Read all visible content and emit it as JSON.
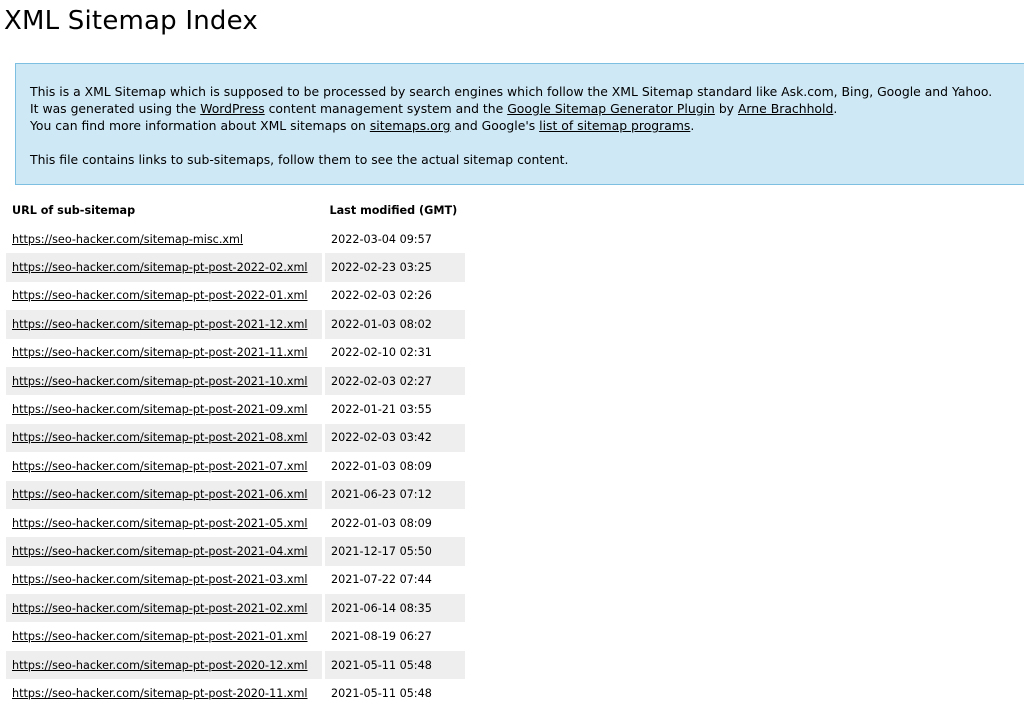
{
  "page": {
    "title": "XML Sitemap Index"
  },
  "intro": {
    "line1": "This is a XML Sitemap which is supposed to be processed by search engines which follow the XML Sitemap standard like Ask.com, Bing, Google and Yahoo.",
    "line2_pre": "It was generated using the ",
    "wordpress_link": "WordPress",
    "line2_mid1": " content management system and the ",
    "plugin_link": "Google Sitemap Generator Plugin",
    "line2_mid2": " by ",
    "author_link": "Arne Brachhold",
    "line2_post": ".",
    "line3_pre": "You can find more information about XML sitemaps on ",
    "sitemaps_link": "sitemaps.org",
    "line3_mid": " and Google's ",
    "programs_link": "list of sitemap programs",
    "line3_post": ".",
    "line4": "This file contains links to sub-sitemaps, follow them to see the actual sitemap content."
  },
  "table": {
    "headers": {
      "url": "URL of sub-sitemap",
      "modified": "Last modified (GMT)"
    },
    "rows": [
      {
        "url": "https://seo-hacker.com/sitemap-misc.xml",
        "modified": "2022-03-04 09:57"
      },
      {
        "url": "https://seo-hacker.com/sitemap-pt-post-2022-02.xml",
        "modified": "2022-02-23 03:25"
      },
      {
        "url": "https://seo-hacker.com/sitemap-pt-post-2022-01.xml",
        "modified": "2022-02-03 02:26"
      },
      {
        "url": "https://seo-hacker.com/sitemap-pt-post-2021-12.xml",
        "modified": "2022-01-03 08:02"
      },
      {
        "url": "https://seo-hacker.com/sitemap-pt-post-2021-11.xml",
        "modified": "2022-02-10 02:31"
      },
      {
        "url": "https://seo-hacker.com/sitemap-pt-post-2021-10.xml",
        "modified": "2022-02-03 02:27"
      },
      {
        "url": "https://seo-hacker.com/sitemap-pt-post-2021-09.xml",
        "modified": "2022-01-21 03:55"
      },
      {
        "url": "https://seo-hacker.com/sitemap-pt-post-2021-08.xml",
        "modified": "2022-02-03 03:42"
      },
      {
        "url": "https://seo-hacker.com/sitemap-pt-post-2021-07.xml",
        "modified": "2022-01-03 08:09"
      },
      {
        "url": "https://seo-hacker.com/sitemap-pt-post-2021-06.xml",
        "modified": "2021-06-23 07:12"
      },
      {
        "url": "https://seo-hacker.com/sitemap-pt-post-2021-05.xml",
        "modified": "2022-01-03 08:09"
      },
      {
        "url": "https://seo-hacker.com/sitemap-pt-post-2021-04.xml",
        "modified": "2021-12-17 05:50"
      },
      {
        "url": "https://seo-hacker.com/sitemap-pt-post-2021-03.xml",
        "modified": "2021-07-22 07:44"
      },
      {
        "url": "https://seo-hacker.com/sitemap-pt-post-2021-02.xml",
        "modified": "2021-06-14 08:35"
      },
      {
        "url": "https://seo-hacker.com/sitemap-pt-post-2021-01.xml",
        "modified": "2021-08-19 06:27"
      },
      {
        "url": "https://seo-hacker.com/sitemap-pt-post-2020-12.xml",
        "modified": "2021-05-11 05:48"
      },
      {
        "url": "https://seo-hacker.com/sitemap-pt-post-2020-11.xml",
        "modified": "2021-05-11 05:48"
      }
    ]
  },
  "colors": {
    "intro_background": "#cfe8f6",
    "intro_border": "#7cbfe1",
    "row_alt_background": "#eeeeee"
  }
}
